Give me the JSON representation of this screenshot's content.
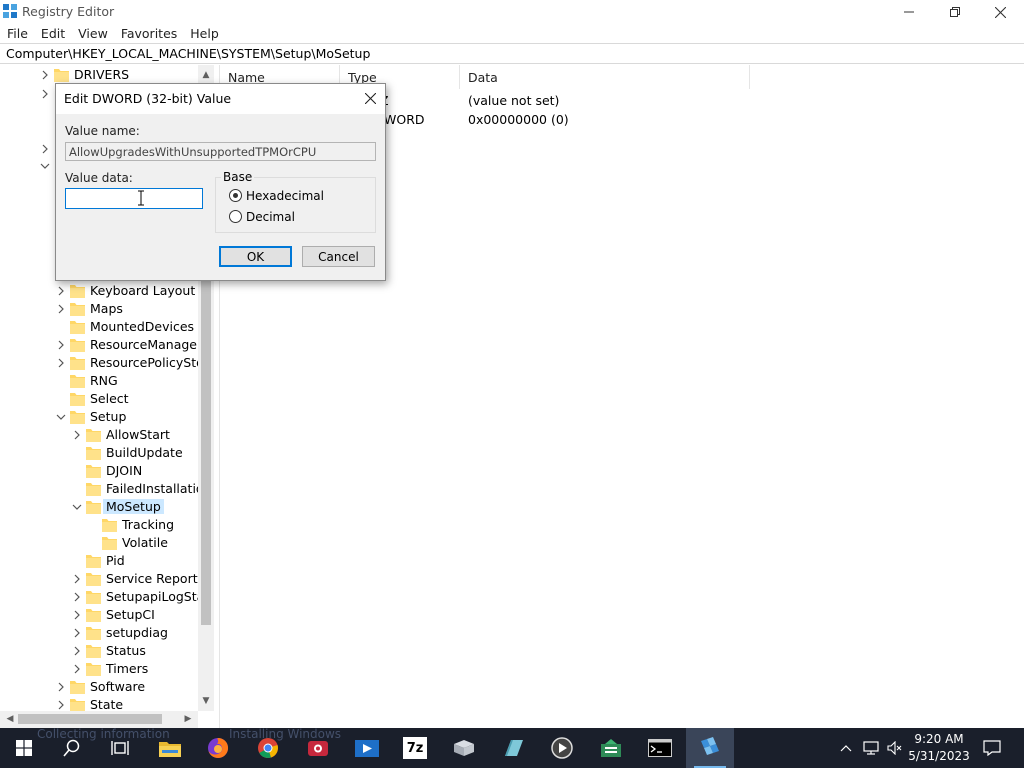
{
  "window": {
    "title": "Registry Editor"
  },
  "menu": [
    "File",
    "Edit",
    "View",
    "Favorites",
    "Help"
  ],
  "address": "Computer\\HKEY_LOCAL_MACHINE\\SYSTEM\\Setup\\MoSetup",
  "tree": {
    "items": [
      {
        "label": "DRIVERS",
        "level": 0,
        "chevron": "right",
        "folder": true
      },
      {
        "label": "",
        "level": 0,
        "chevron": "right",
        "folder": false
      },
      {
        "label": "",
        "level": 0,
        "chevron": "none",
        "folder": false
      },
      {
        "label": "",
        "level": 0,
        "chevron": "right",
        "folder": false
      },
      {
        "label": "",
        "level": 0,
        "chevron": "down",
        "folder": false
      },
      {
        "label": "Keyboard Layout",
        "level": 1,
        "chevron": "right",
        "folder": true
      },
      {
        "label": "Maps",
        "level": 1,
        "chevron": "right",
        "folder": true
      },
      {
        "label": "MountedDevices",
        "level": 1,
        "chevron": "none",
        "folder": true
      },
      {
        "label": "ResourceManager",
        "level": 1,
        "chevron": "right",
        "folder": true
      },
      {
        "label": "ResourcePolicyStore",
        "level": 1,
        "chevron": "right",
        "folder": true
      },
      {
        "label": "RNG",
        "level": 1,
        "chevron": "none",
        "folder": true
      },
      {
        "label": "Select",
        "level": 1,
        "chevron": "none",
        "folder": true
      },
      {
        "label": "Setup",
        "level": 1,
        "chevron": "down",
        "folder": true
      },
      {
        "label": "AllowStart",
        "level": 2,
        "chevron": "right",
        "folder": true
      },
      {
        "label": "BuildUpdate",
        "level": 2,
        "chevron": "none",
        "folder": true
      },
      {
        "label": "DJOIN",
        "level": 2,
        "chevron": "none",
        "folder": true
      },
      {
        "label": "FailedInstallations",
        "level": 2,
        "chevron": "none",
        "folder": true
      },
      {
        "label": "MoSetup",
        "level": 2,
        "chevron": "down",
        "folder": true,
        "selected": true
      },
      {
        "label": "Tracking",
        "level": 3,
        "chevron": "none",
        "folder": true
      },
      {
        "label": "Volatile",
        "level": 3,
        "chevron": "none",
        "folder": true
      },
      {
        "label": "Pid",
        "level": 2,
        "chevron": "none",
        "folder": true
      },
      {
        "label": "Service Reporting",
        "level": 2,
        "chevron": "right",
        "folder": true
      },
      {
        "label": "SetupapiLogStatus",
        "level": 2,
        "chevron": "right",
        "folder": true
      },
      {
        "label": "SetupCI",
        "level": 2,
        "chevron": "right",
        "folder": true
      },
      {
        "label": "setupdiag",
        "level": 2,
        "chevron": "right",
        "folder": true
      },
      {
        "label": "Status",
        "level": 2,
        "chevron": "right",
        "folder": true
      },
      {
        "label": "Timers",
        "level": 2,
        "chevron": "right",
        "folder": true
      },
      {
        "label": "Software",
        "level": 1,
        "chevron": "right",
        "folder": true
      },
      {
        "label": "State",
        "level": 1,
        "chevron": "right",
        "folder": true
      }
    ]
  },
  "list": {
    "columns": [
      "Name",
      "Type",
      "Data"
    ],
    "rows": [
      {
        "type": "Z",
        "data": "(value not set)"
      },
      {
        "type": "WORD",
        "data": "0x00000000 (0)"
      }
    ]
  },
  "dialog": {
    "title": "Edit DWORD (32-bit) Value",
    "value_name_label": "Value name:",
    "value_name": "AllowUpgradesWithUnsupportedTPMOrCPU",
    "value_data_label": "Value data:",
    "value_data": "",
    "base_label": "Base",
    "hex_label": "Hexadecimal",
    "dec_label": "Decimal",
    "ok_label": "OK",
    "cancel_label": "Cancel"
  },
  "taskbar": {
    "ghost_text_1": "Collecting information",
    "ghost_text_2": "Installing Windows",
    "time": "9:20 AM",
    "date": "5/31/2023",
    "zip_label": "7z"
  },
  "colors": {
    "accent": "#0078d7",
    "selection": "#cce8ff",
    "folder": "#ffd766",
    "taskbar": "#1a1f2b"
  }
}
